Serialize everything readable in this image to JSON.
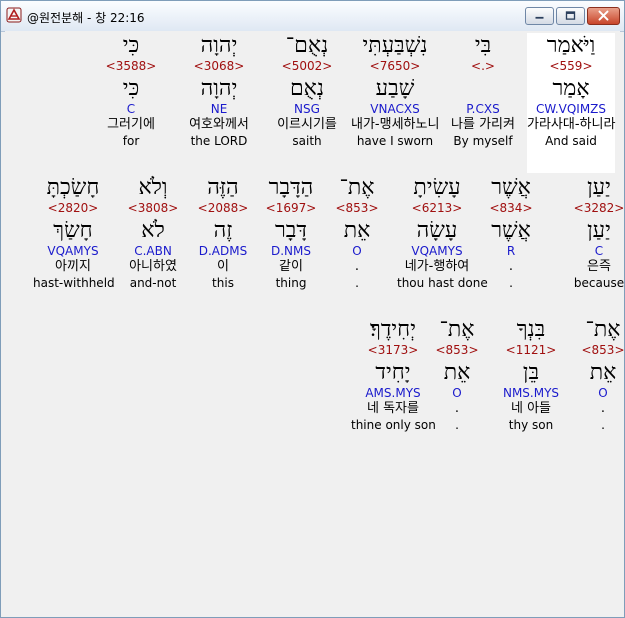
{
  "window": {
    "title": "@원전분해 - 창 22:16",
    "minimize_label": "",
    "maximize_label": "",
    "close_label": ""
  },
  "colors": {
    "strong_number": "#a01010",
    "morphology": "#1a1acc",
    "selected_background": "#ffffff"
  },
  "rows": [
    [
      {
        "heb": "וַיֹּאמַר",
        "strong": "<559>",
        "lemma": "אָמַר",
        "morph": "CW.VQIMZS",
        "kor": "가라사대-하니라",
        "eng": "And said",
        "selected": true
      },
      {
        "heb": "בִּי",
        "strong": "<.>",
        "lemma": "",
        "morph": "P.CXS",
        "kor": "나를 가리켜",
        "eng": "By myself"
      },
      {
        "heb": "נִשְׁבַּעְתִּי",
        "strong": "<7650>",
        "lemma": "שָׁבַע",
        "morph": "VNACXS",
        "kor": "내가-맹세하노니",
        "eng": "have I sworn"
      },
      {
        "heb": "נְאֻם־",
        "strong": "<5002>",
        "lemma": "נְאֻם",
        "morph": "NSG",
        "kor": "이르시기를",
        "eng": "saith"
      },
      {
        "heb": "יְהוָה",
        "strong": "<3068>",
        "lemma": "יְהוָה",
        "morph": "NE",
        "kor": "여호와께서",
        "eng": "the LORD"
      },
      {
        "heb": "כִּי",
        "strong": "<3588>",
        "lemma": "כִּי",
        "morph": "C",
        "kor": "그러기에",
        "eng": "for"
      }
    ],
    [
      {
        "heb": "יַעַן",
        "strong": "<3282>",
        "lemma": "יַעַן",
        "morph": "C",
        "kor": "은즉",
        "eng": "because"
      },
      {
        "heb": "אֲשֶׁר",
        "strong": "<834>",
        "lemma": "אֲשֶׁר",
        "morph": "R",
        "kor": ".",
        "eng": "."
      },
      {
        "heb": "עָשִׂיתָ",
        "strong": "<6213>",
        "lemma": "עָשָׂה",
        "morph": "VQAMYS",
        "kor": "네가-행하여",
        "eng": "thou hast done"
      },
      {
        "heb": "אֶת־",
        "strong": "<853>",
        "lemma": "אֵת",
        "morph": "O",
        "kor": ".",
        "eng": "."
      },
      {
        "heb": "הַדָּבָר",
        "strong": "<1697>",
        "lemma": "דָּבָר",
        "morph": "D.NMS",
        "kor": "같이",
        "eng": "thing"
      },
      {
        "heb": "הַזֶּה",
        "strong": "<2088>",
        "lemma": "זֶה",
        "morph": "D.ADMS",
        "kor": "이",
        "eng": "this"
      },
      {
        "heb": "וְלֹא",
        "strong": "<3808>",
        "lemma": "לֹא",
        "morph": "C.ABN",
        "kor": "아니하였",
        "eng": "and-not"
      },
      {
        "heb": "חָשַׂכְתָּ",
        "strong": "<2820>",
        "lemma": "חָשַׂךְ",
        "morph": "VQAMYS",
        "kor": "아끼지",
        "eng": "hast-withheld"
      }
    ],
    [
      {
        "heb": "אֶת־",
        "strong": "<853>",
        "lemma": "אֵת",
        "morph": "O",
        "kor": ".",
        "eng": "."
      },
      {
        "heb": "בִּנְךָ",
        "strong": "<1121>",
        "lemma": "בֵּן",
        "morph": "NMS.MYS",
        "kor": "네 아들",
        "eng": "thy son"
      },
      {
        "heb": "אֶת־",
        "strong": "<853>",
        "lemma": "אֵת",
        "morph": "O",
        "kor": ".",
        "eng": "."
      },
      {
        "heb": "יְחִידֶךָ׃",
        "strong": "<3173>",
        "lemma": "יָחִיד",
        "morph": "AMS.MYS",
        "kor": "네 독자를",
        "eng": "thine only son"
      }
    ]
  ]
}
